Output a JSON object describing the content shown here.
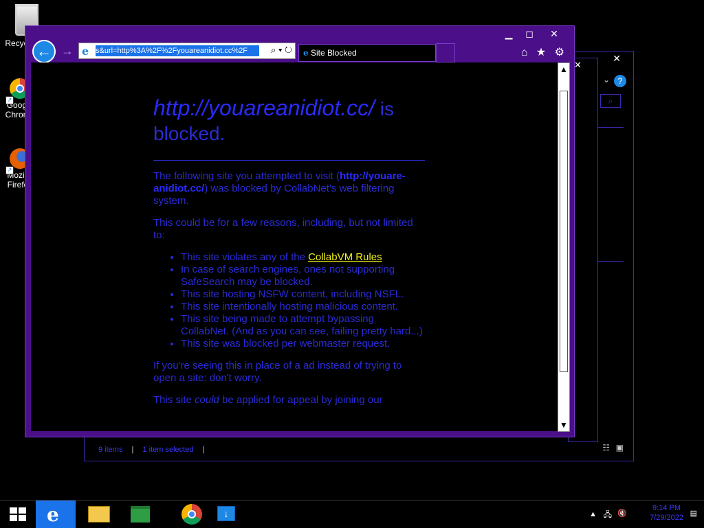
{
  "desktop": {
    "icons": [
      {
        "label": "Recycle Bin"
      },
      {
        "label": "Google Chrome"
      },
      {
        "label": "Mozilla Firefox"
      }
    ]
  },
  "explorer": {
    "status_items": "9 items",
    "status_selected": "1 item selected"
  },
  "ie": {
    "address": "s&url=http%3A%2F%2Fyouareanidiot.cc%2F",
    "tab_title": "Site Blocked",
    "icons": {
      "back": "back-arrow-icon",
      "forward": "forward-arrow-icon",
      "home": "home-icon",
      "favorites": "star-icon",
      "tools": "gear-icon",
      "search": "search-icon",
      "refresh": "refresh-icon"
    }
  },
  "page": {
    "heading_url": "http://youareanidiot.cc/",
    "heading_rest": " is blocked.",
    "p1_prefix": "The following site you attempted to visit (",
    "p1_url": "http://youare-anidiot.cc/",
    "p1_suffix": ") was blocked by CollabNet's web filtering system.",
    "p2": "This could be for a few reasons, including, but not limited to:",
    "reasons": [
      {
        "prefix": "This site violates any of the ",
        "link": "CollabVM Rules"
      },
      {
        "prefix": "In case of search engines, ones not supporting SafeSearch may be blocked.",
        "link": ""
      },
      {
        "prefix": "This site hosting NSFW content, including NSFL.",
        "link": ""
      },
      {
        "prefix": "This site intentionally hosting malicious content.",
        "link": ""
      },
      {
        "prefix": "This site being made to attempt bypassing CollabNet. (And as you can see, failing pretty hard...)",
        "link": ""
      },
      {
        "prefix": "This site was blocked per webmaster request.",
        "link": ""
      }
    ],
    "p3": "If you're seeing this in place of a ad instead of trying to open a site: don't worry.",
    "p4_prefix": "This site ",
    "p4_em": "could",
    "p4_suffix": " be applied for appeal by joining our"
  },
  "taskbar": {
    "items": [
      "start-icon",
      "internet-explorer-icon",
      "file-explorer-icon",
      "store-icon",
      "chrome-icon",
      "download-icon"
    ],
    "clock_time": "9:14 PM",
    "clock_date": "7/29/2022"
  },
  "colors": {
    "window_frame": "#4b0f8a",
    "text_blue": "#2b2bd6",
    "link_yellow": "#f2f21a",
    "accent": "#1a73e8"
  }
}
